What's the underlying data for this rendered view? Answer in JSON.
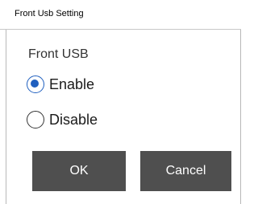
{
  "window": {
    "title": "Front Usb Setting"
  },
  "group": {
    "label": "Front USB",
    "options": [
      {
        "label": "Enable",
        "selected": true
      },
      {
        "label": "Disable",
        "selected": false
      }
    ]
  },
  "buttons": {
    "ok_label": "OK",
    "cancel_label": "Cancel"
  },
  "colors": {
    "accent": "#1f5fbf",
    "button_bg": "#4f4f4f"
  }
}
